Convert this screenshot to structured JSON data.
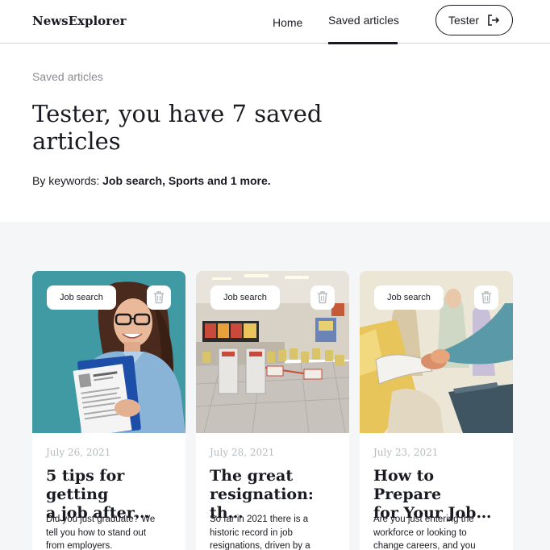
{
  "header": {
    "logo": "NewsExplorer",
    "nav_home": "Home",
    "nav_saved": "Saved articles",
    "user_name": "Tester"
  },
  "hero": {
    "caption": "Saved articles",
    "title": "Tester, you have 7 saved articles",
    "keywords_prefix": "By keywords: ",
    "keywords_bold": "Job search, Sports and 1 more."
  },
  "cards": [
    {
      "keyword": "Job search",
      "date": "July 26, 2021",
      "title_lines": [
        "5 tips for getting",
        "a job after…"
      ],
      "text_lines": [
        "Did you just graduate? We",
        "tell you how to stand out",
        "from employers."
      ],
      "image": "woman-holding-resume"
    },
    {
      "keyword": "Job search",
      "date": "July 28, 2021",
      "title_lines": [
        "The great",
        "resignation: th…"
      ],
      "text_lines": [
        "So far in 2021 there is a",
        "historic record in job",
        "resignations, driven by a"
      ],
      "image": "empty-fast-food-restaurant"
    },
    {
      "keyword": "Job search",
      "date": "July 23, 2021",
      "title_lines": [
        "How to Prepare",
        "for Your Job…"
      ],
      "text_lines": [
        "Are you just entering the",
        "workforce or looking to",
        "change careers, and you"
      ],
      "image": "handshake-illustration"
    }
  ],
  "colors": {
    "text": "#1a1b22",
    "muted": "#8b8c93",
    "date": "#b6bcbf",
    "section_bg": "#f5f6f7"
  }
}
